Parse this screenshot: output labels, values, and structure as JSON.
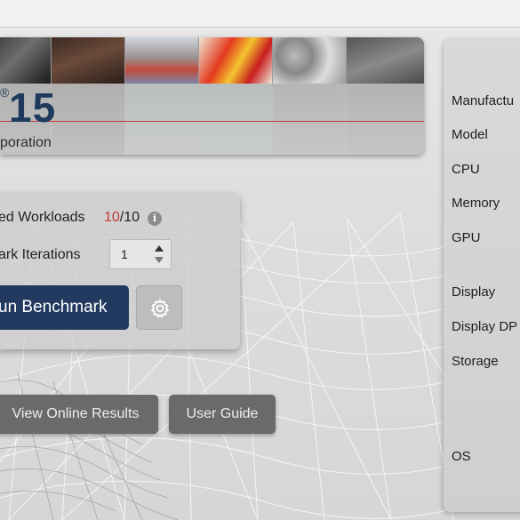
{
  "brand": {
    "version": "15",
    "registered": "®",
    "company_fragment": "poration"
  },
  "controls": {
    "workloads_label": "ed Workloads",
    "workloads_selected": "10",
    "workloads_total": "/10",
    "iterations_label": "ark Iterations",
    "iterations_value": "1"
  },
  "buttons": {
    "run": "un Benchmark",
    "view_online": "View Online Results",
    "user_guide": "User Guide"
  },
  "system_info": {
    "manufacturer": "Manufactu",
    "model": "Model",
    "cpu": "CPU",
    "memory": "Memory",
    "gpu": "GPU",
    "display": "Display",
    "display_dpi": "Display DP",
    "storage": "Storage",
    "os": "OS"
  },
  "colors": {
    "accent_red": "#c43a3a",
    "run_button": "#223a60",
    "brand_navy": "#1f3a5c"
  },
  "icons": {
    "info": "info-icon",
    "settings": "gear-icon",
    "stepper_up": "chevron-up-icon",
    "stepper_down": "chevron-down-icon"
  }
}
